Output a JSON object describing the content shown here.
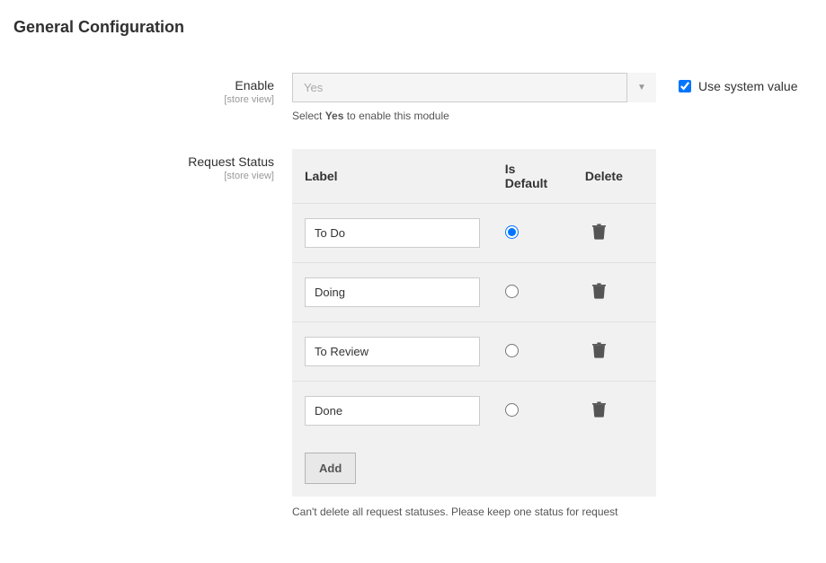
{
  "section": {
    "title": "General Configuration"
  },
  "fields": {
    "enable": {
      "label": "Enable",
      "scope": "[store view]",
      "value": "Yes",
      "note_prefix": "Select ",
      "note_strong": "Yes",
      "note_suffix": " to enable this module",
      "use_system_label": "Use system value"
    },
    "request_status": {
      "label": "Request Status",
      "scope": "[store view]",
      "columns": {
        "label": "Label",
        "is_default": "Is Default",
        "delete": "Delete"
      },
      "rows": [
        {
          "label": "To Do",
          "is_default": true
        },
        {
          "label": "Doing",
          "is_default": false
        },
        {
          "label": "To Review",
          "is_default": false
        },
        {
          "label": "Done",
          "is_default": false
        }
      ],
      "add_button": "Add",
      "note": "Can't delete all request statuses. Please keep one status for request"
    }
  }
}
